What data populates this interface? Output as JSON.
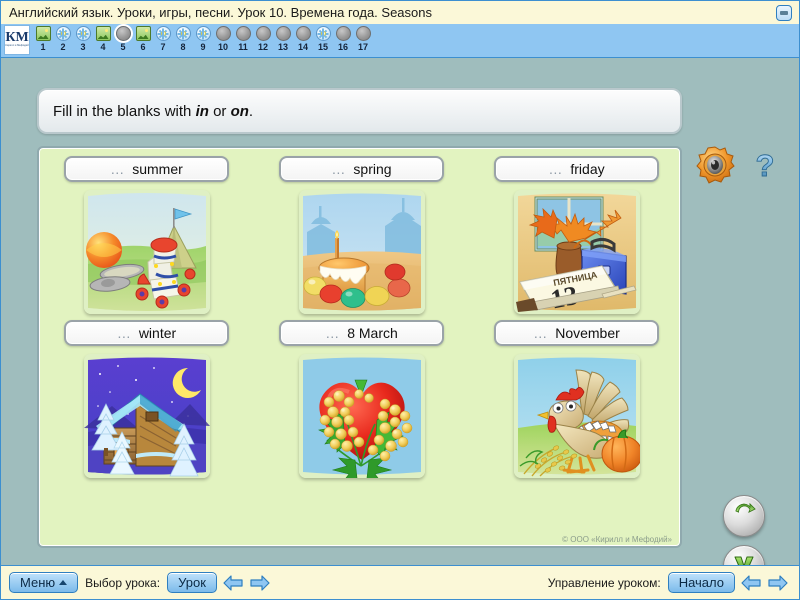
{
  "window": {
    "title": "Английский язык. Уроки, игры, песни. Урок 10. Времена года. Seasons",
    "minimize_label": "—"
  },
  "navbar": {
    "logo_mark": "КМ",
    "logo_sub": "Кирилл и Мефодий",
    "items": [
      {
        "num": "1",
        "icon": "image-icon",
        "state": "visited"
      },
      {
        "num": "2",
        "icon": "snowflake-icon",
        "state": "visited"
      },
      {
        "num": "3",
        "icon": "snowflake-icon",
        "state": "visited"
      },
      {
        "num": "4",
        "icon": "image-icon",
        "state": "visited"
      },
      {
        "num": "5",
        "icon": "bullet-icon",
        "state": "current"
      },
      {
        "num": "6",
        "icon": "image-icon",
        "state": "visited"
      },
      {
        "num": "7",
        "icon": "snowflake-icon",
        "state": "visited"
      },
      {
        "num": "8",
        "icon": "snowflake-icon",
        "state": "visited"
      },
      {
        "num": "9",
        "icon": "snowflake-icon",
        "state": "visited"
      },
      {
        "num": "10",
        "icon": "bullet-icon",
        "state": "default"
      },
      {
        "num": "11",
        "icon": "bullet-icon",
        "state": "default"
      },
      {
        "num": "12",
        "icon": "bullet-icon",
        "state": "default"
      },
      {
        "num": "13",
        "icon": "bullet-icon",
        "state": "default"
      },
      {
        "num": "14",
        "icon": "bullet-icon",
        "state": "default"
      },
      {
        "num": "15",
        "icon": "snowflake-icon",
        "state": "visited"
      },
      {
        "num": "16",
        "icon": "bullet-icon",
        "state": "default"
      },
      {
        "num": "17",
        "icon": "bullet-icon",
        "state": "default"
      }
    ]
  },
  "instruction": {
    "prefix": "Fill in the blanks with ",
    "word1": "in",
    "middle": " or ",
    "word2": "on",
    "suffix": ".",
    "speaker_icon": "speaker-icon",
    "help_icon": "help-icon"
  },
  "exercise": {
    "blank": "…",
    "items": [
      {
        "blank": "…",
        "word": "summer",
        "image": "summer-camp-picture"
      },
      {
        "blank": "…",
        "word": "spring",
        "image": "easter-cake-picture"
      },
      {
        "blank": "…",
        "word": "friday",
        "image": "calendar-friday-13-picture"
      },
      {
        "blank": "…",
        "word": "winter",
        "image": "snowy-cabin-picture"
      },
      {
        "blank": "…",
        "word": "8 March",
        "image": "mimosa-heart-picture"
      },
      {
        "blank": "…",
        "word": "November",
        "image": "turkey-pumpkin-picture"
      }
    ],
    "copyright": "© ООО «Кирилл и Мефодий»"
  },
  "actions": {
    "reset_label": "reset-icon",
    "check_label": "check-icon"
  },
  "bottombar": {
    "menu_label": "Меню",
    "lesson_select_label": "Выбор урока:",
    "lesson_button": "Урок",
    "lesson_control_label": "Управление уроком:",
    "start_button": "Начало",
    "prev_arrow": "arrow-left-icon",
    "next_arrow": "arrow-right-icon"
  },
  "colors": {
    "frame": "#9fbdbd",
    "panel": "#e2f3c0",
    "titlebar": "#fbf8d8",
    "navbar": "#8fc6f2",
    "accent_blue": "#3c8fd0"
  }
}
